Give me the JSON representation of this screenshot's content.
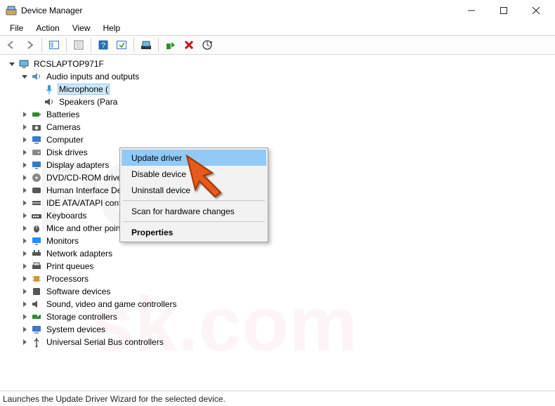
{
  "window": {
    "title": "Device Manager",
    "controls": {
      "minimize": "–",
      "maximize": "□",
      "close": "✕"
    }
  },
  "menubar": [
    "File",
    "Action",
    "View",
    "Help"
  ],
  "tree": {
    "root": {
      "label": "RCSLAPTOP971F",
      "expanded": true
    },
    "audio": {
      "label": "Audio inputs and outputs",
      "expanded": true,
      "children": [
        {
          "key": "mic",
          "label": "Microphone (",
          "selected": true,
          "iconColor": "#3399dd"
        },
        {
          "key": "spk",
          "label": "Speakers (Para",
          "iconColor": "#555"
        }
      ]
    },
    "categories": [
      {
        "key": "batteries",
        "label": "Batteries",
        "iconColor": "#2f8f2f"
      },
      {
        "key": "cameras",
        "label": "Cameras",
        "iconColor": "#555"
      },
      {
        "key": "computer",
        "label": "Computer",
        "iconColor": "#3a78c9"
      },
      {
        "key": "diskdrives",
        "label": "Disk drives",
        "iconColor": "#888"
      },
      {
        "key": "display",
        "label": "Display adapters",
        "iconColor": "#3a78c9"
      },
      {
        "key": "dvd",
        "label": "DVD/CD-ROM drives",
        "iconColor": "#888"
      },
      {
        "key": "hid",
        "label": "Human Interface Devices",
        "iconColor": "#555"
      },
      {
        "key": "ide",
        "label": "IDE ATA/ATAPI controllers",
        "iconColor": "#555"
      },
      {
        "key": "keyboards",
        "label": "Keyboards",
        "iconColor": "#555"
      },
      {
        "key": "mice",
        "label": "Mice and other pointing devices",
        "iconColor": "#555"
      },
      {
        "key": "monitors",
        "label": "Monitors",
        "iconColor": "#1e90ff"
      },
      {
        "key": "netadapters",
        "label": "Network adapters",
        "iconColor": "#555"
      },
      {
        "key": "printqueues",
        "label": "Print queues",
        "iconColor": "#555"
      },
      {
        "key": "processors",
        "label": "Processors",
        "iconColor": "#d19a33"
      },
      {
        "key": "softwaredev",
        "label": "Software devices",
        "iconColor": "#555"
      },
      {
        "key": "sound",
        "label": "Sound, video and game controllers",
        "iconColor": "#555"
      },
      {
        "key": "storage",
        "label": "Storage controllers",
        "iconColor": "#2f8f2f"
      },
      {
        "key": "system",
        "label": "System devices",
        "iconColor": "#3a78c9"
      },
      {
        "key": "usb",
        "label": "Universal Serial Bus controllers",
        "iconColor": "#555"
      }
    ]
  },
  "context_menu": {
    "items": [
      {
        "label": "Update driver",
        "highlight": true
      },
      {
        "label": "Disable device"
      },
      {
        "label": "Uninstall device"
      },
      {
        "sep": true
      },
      {
        "label": "Scan for hardware changes"
      },
      {
        "sep": true
      },
      {
        "label": "Properties",
        "bold": true
      }
    ]
  },
  "statusbar": "Launches the Update Driver Wizard for the selected device."
}
